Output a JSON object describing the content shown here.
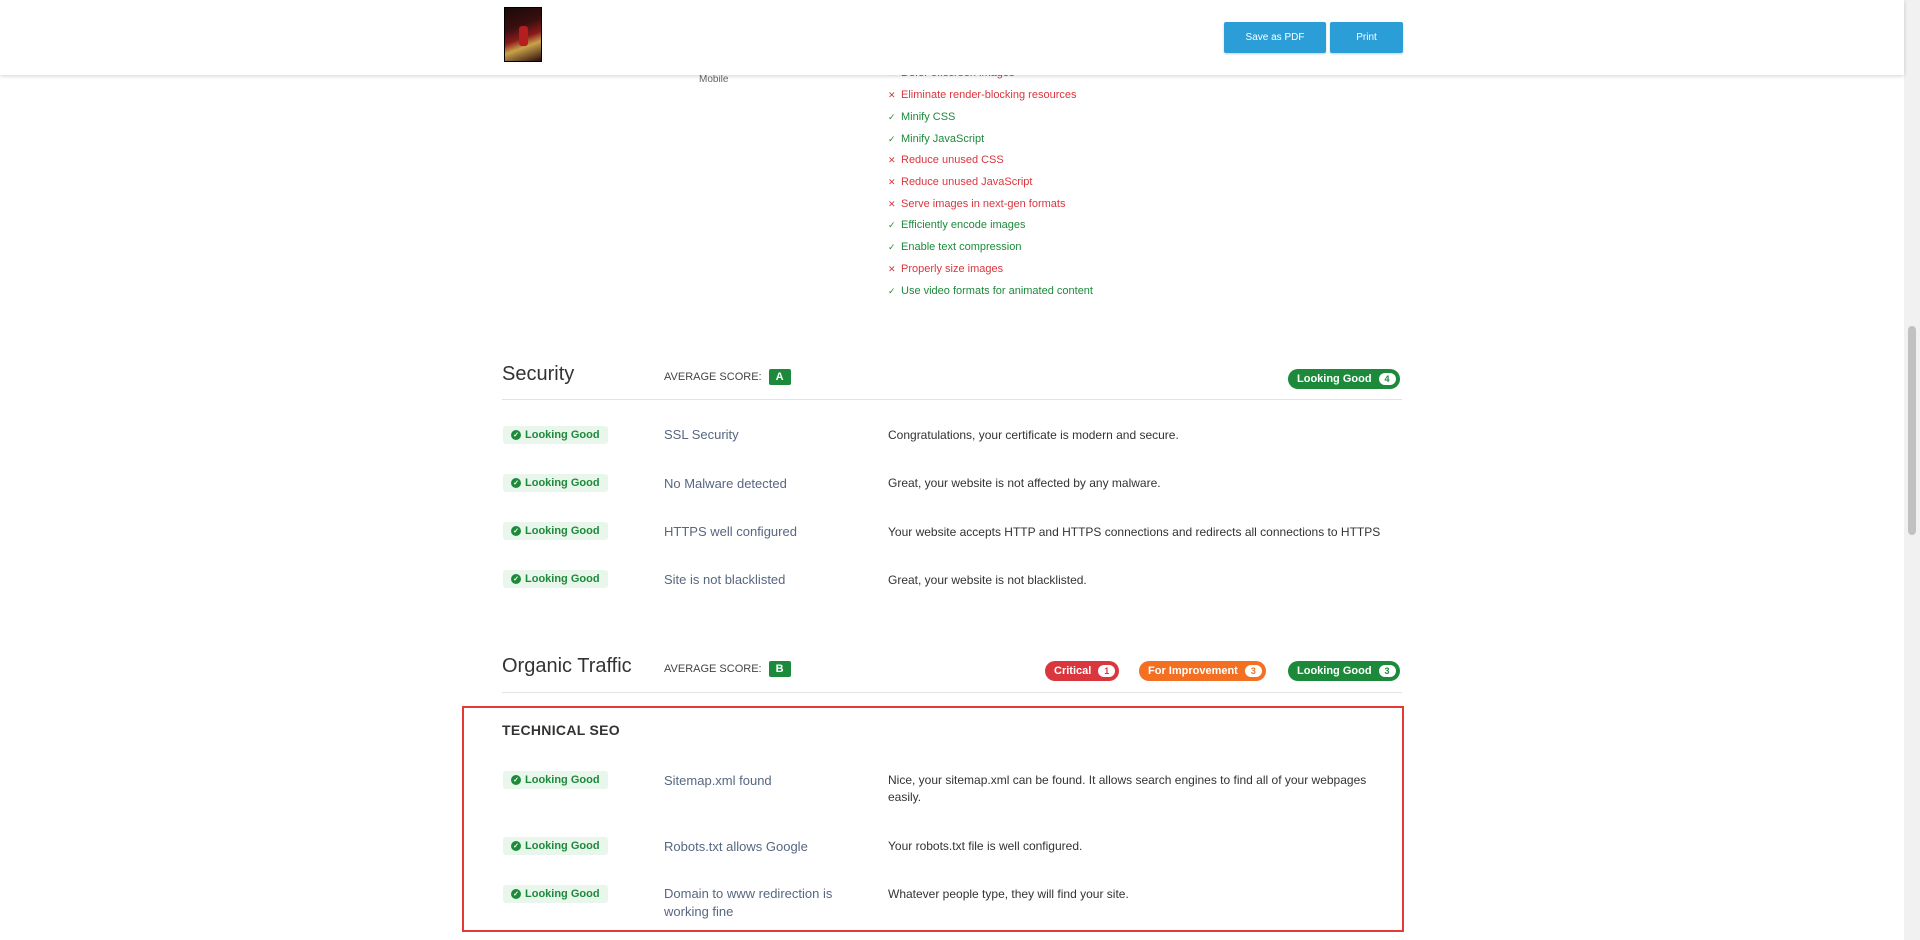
{
  "header": {
    "save_pdf_label": "Save as PDF",
    "print_label": "Print"
  },
  "performance": {
    "partial_top_item": "Defer offscreen images",
    "mobile_label": "Mobile",
    "audits": [
      {
        "label": "Eliminate render-blocking resources",
        "status": "fail"
      },
      {
        "label": "Minify CSS",
        "status": "pass"
      },
      {
        "label": "Minify JavaScript",
        "status": "pass"
      },
      {
        "label": "Reduce unused CSS",
        "status": "fail"
      },
      {
        "label": "Reduce unused JavaScript",
        "status": "fail"
      },
      {
        "label": "Serve images in next-gen formats",
        "status": "fail"
      },
      {
        "label": "Efficiently encode images",
        "status": "pass"
      },
      {
        "label": "Enable text compression",
        "status": "pass"
      },
      {
        "label": "Properly size images",
        "status": "fail"
      },
      {
        "label": "Use video formats for animated content",
        "status": "pass"
      }
    ]
  },
  "security": {
    "title": "Security",
    "avg_label": "AVERAGE SCORE:",
    "grade": "A",
    "summary": {
      "label": "Looking Good",
      "count": "4"
    },
    "rows": [
      {
        "status": "Looking Good",
        "title": "SSL Security",
        "desc": "Congratulations, your certificate is modern and secure."
      },
      {
        "status": "Looking Good",
        "title": "No Malware detected",
        "desc": "Great, your website is not affected by any malware."
      },
      {
        "status": "Looking Good",
        "title": "HTTPS well configured",
        "desc": "Your website accepts HTTP and HTTPS connections and redirects all connections to HTTPS"
      },
      {
        "status": "Looking Good",
        "title": "Site is not blacklisted",
        "desc": "Great, your website is not blacklisted."
      }
    ]
  },
  "organic": {
    "title": "Organic Traffic",
    "avg_label": "AVERAGE SCORE:",
    "grade": "B",
    "critical": {
      "label": "Critical",
      "count": "1"
    },
    "improvement": {
      "label": "For Improvement",
      "count": "3"
    },
    "good": {
      "label": "Looking Good",
      "count": "3"
    },
    "technical_seo": {
      "title": "TECHNICAL SEO",
      "rows": [
        {
          "status": "Looking Good",
          "title": "Sitemap.xml found",
          "desc": "Nice, your sitemap.xml can be found. It allows search engines to find all of your webpages easily."
        },
        {
          "status": "Looking Good",
          "title": "Robots.txt allows Google",
          "desc": "Your robots.txt file is well configured."
        },
        {
          "status": "Looking Good",
          "title": "Domain to www redirection is working fine",
          "desc": "Whatever people type, they will find your site."
        }
      ]
    }
  }
}
